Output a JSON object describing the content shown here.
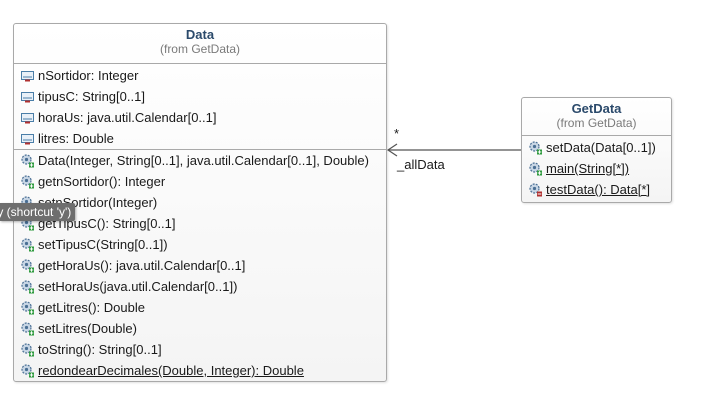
{
  "classes": {
    "data": {
      "name": "Data",
      "from": "(from GetData)",
      "attributes": [
        {
          "text": "nSortidor: Integer"
        },
        {
          "text": "tipusC: String[0..1]"
        },
        {
          "text": "horaUs: java.util.Calendar[0..1]"
        },
        {
          "text": "litres: Double"
        }
      ],
      "operations": [
        {
          "text": "Data(Integer, String[0..1], java.util.Calendar[0..1], Double)"
        },
        {
          "text": "getnSortidor(): Integer"
        },
        {
          "text": "setnSortidor(Integer)"
        },
        {
          "text": "getTipusC(): String[0..1]"
        },
        {
          "text": "setTipusC(String[0..1])"
        },
        {
          "text": "getHoraUs(): java.util.Calendar[0..1]"
        },
        {
          "text": "setHoraUs(java.util.Calendar[0..1])"
        },
        {
          "text": "getLitres(): Double"
        },
        {
          "text": "setLitres(Double)"
        },
        {
          "text": "toString(): String[0..1]"
        },
        {
          "text": "redondearDecimales(Double, Integer): Double"
        }
      ]
    },
    "getdata": {
      "name": "GetData",
      "from": "(from GetData)",
      "operations": [
        {
          "text": "setData(Data[0..1])"
        },
        {
          "text": "main(String[*])"
        },
        {
          "text": "testData(): Data[*]"
        }
      ]
    }
  },
  "association": {
    "multiplicity": "*",
    "role": "_allData"
  },
  "tooltip": {
    "text": "ency (shortcut 'y')"
  },
  "colors": {
    "class_name": "#2b4a6b",
    "border": "#a9a9a9",
    "tooltip_bg": "#6e6e6e"
  },
  "icons": {
    "attribute": "field-icon",
    "operation": "method-gear-icon"
  }
}
